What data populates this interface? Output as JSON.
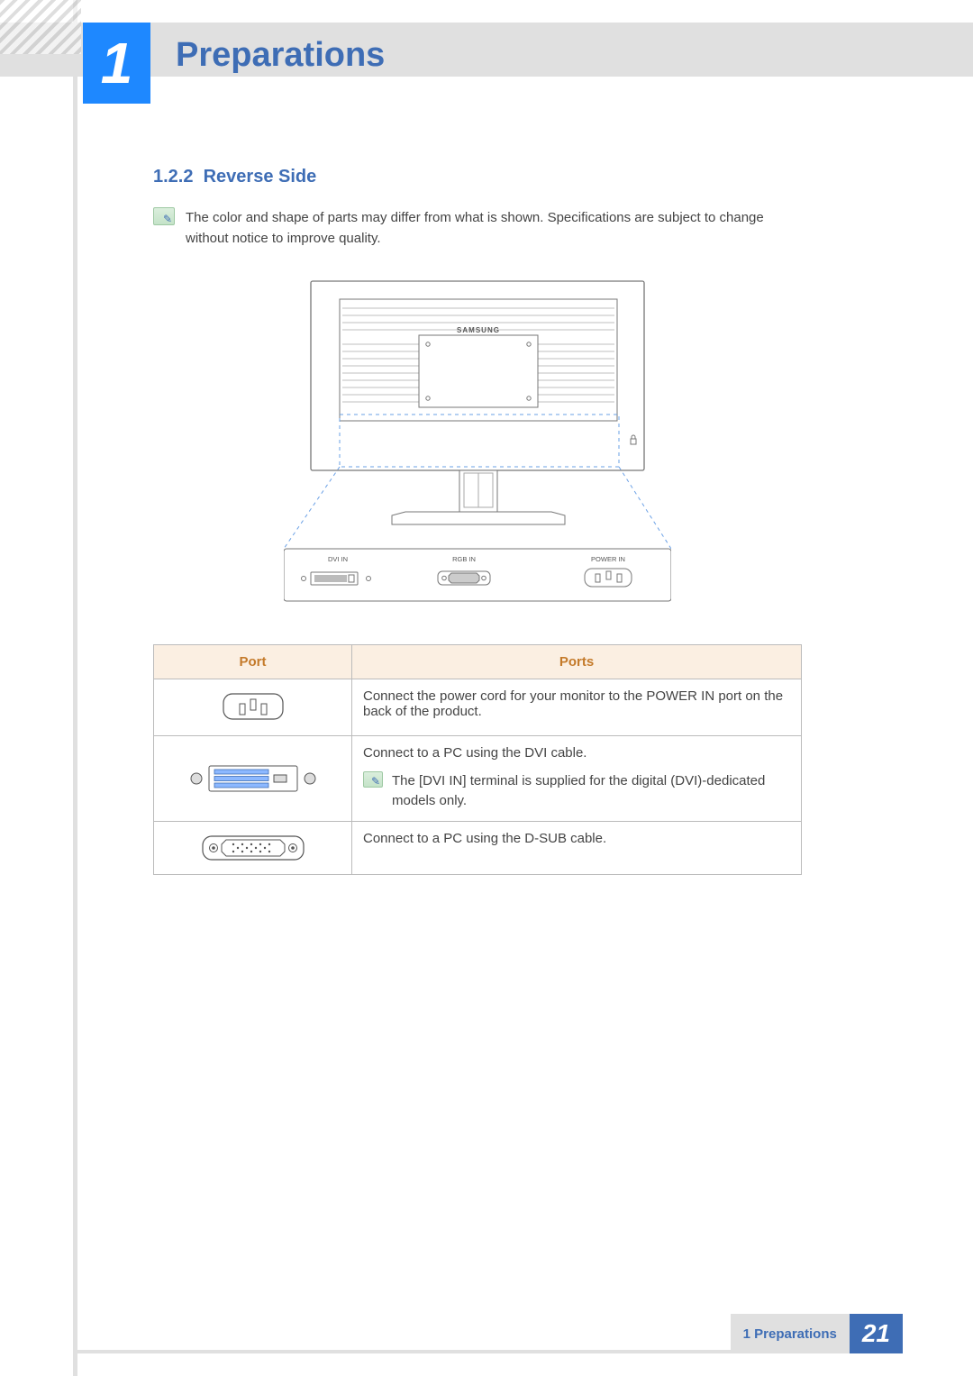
{
  "chapter": {
    "number": "1",
    "title": "Preparations"
  },
  "section": {
    "number": "1.2.2",
    "title": "Reverse Side"
  },
  "note": "The color and shape of parts may differ from what is shown. Specifications are subject to change without notice to improve quality.",
  "diagram": {
    "brand": "SAMSUNG",
    "port_labels": {
      "dvi": "DVI IN",
      "rgb": "RGB IN",
      "power": "POWER IN"
    }
  },
  "table": {
    "headers": {
      "port": "Port",
      "ports": "Ports"
    },
    "rows": [
      {
        "icon": "power-port",
        "desc": "Connect the power cord for your monitor to the POWER IN port on the back of the product."
      },
      {
        "icon": "dvi-port",
        "desc": "Connect to a PC using the DVI cable.",
        "subnote": "The [DVI IN] terminal is supplied for the digital (DVI)-dedicated models only."
      },
      {
        "icon": "dsub-port",
        "desc": "Connect to a PC using the D-SUB cable."
      }
    ]
  },
  "footer": {
    "label": "1 Preparations",
    "page": "21"
  }
}
